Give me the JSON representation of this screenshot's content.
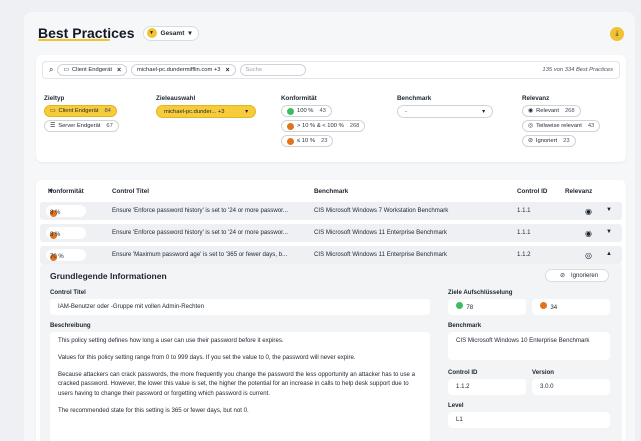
{
  "header": {
    "title": "Best Practices",
    "scope": "Gesamt"
  },
  "search": {
    "chips": [
      "Client Endgerät",
      "michael-pc.dundermifflin.com +3"
    ],
    "placeholder": "Suche",
    "count": "135 von 334 Best Practices"
  },
  "filters": {
    "zieltyp": {
      "label": "Zieltyp",
      "options": [
        {
          "label": "Client Endgerät",
          "count": "84"
        },
        {
          "label": "Server Endgerät",
          "count": "67"
        }
      ]
    },
    "zielauswahl": {
      "label": "Zieleauswahl",
      "value": "michael-pc.dunder... +3"
    },
    "konformitaet": {
      "label": "Konformität",
      "options": [
        {
          "label": "100 %",
          "count": "43"
        },
        {
          "label": "> 10 % & < 100 %",
          "count": "268"
        },
        {
          "label": "≤ 10 %",
          "count": "23"
        }
      ]
    },
    "benchmark": {
      "label": "Benchmark",
      "value": "-"
    },
    "relevanz": {
      "label": "Relevanz",
      "options": [
        {
          "label": "Relevant",
          "count": "268"
        },
        {
          "label": "Teilweise relevant",
          "count": "43"
        },
        {
          "label": "Ignoriert",
          "count": "23"
        }
      ]
    }
  },
  "table": {
    "headers": [
      "Konformität",
      "Control Titel",
      "Benchmark",
      "Control ID",
      "Relevanz"
    ],
    "rows": [
      {
        "pct": "8 %",
        "title": "Ensure 'Enforce password history' is set to '24 or more passwor...",
        "benchmark": "CIS Microsoft Windows 7 Workstation Benchmark",
        "id": "1.1.1"
      },
      {
        "pct": "8 %",
        "title": "Ensure 'Enforce password history' is set to '24 or more passwor...",
        "benchmark": "CIS Microsoft Windows 11 Enterprise Benchmark",
        "id": "1.1.1"
      },
      {
        "pct": "70 %",
        "title": "Ensure 'Maximum password age' is set to '365 or fewer days, b...",
        "benchmark": "CIS Microsoft Windows 11 Enterprise Benchmark",
        "id": "1.1.2"
      }
    ]
  },
  "detail": {
    "heading": "Grundlegende Informationen",
    "ignore_label": "Ignorieren",
    "control_title_label": "Control Titel",
    "control_title_value": "IAM-Benutzer oder -Gruppe mit vollen Admin-Rechten",
    "ziele_label": "Ziele Aufschlüsselung",
    "ziele_green": "78",
    "ziele_orange": "34",
    "beschreibung_label": "Beschreibung",
    "beschreibung": [
      "This policy setting defines how long a user can use their password before it expires.",
      "Values for this policy setting range from 0 to 999 days. If you set the value to 0, the password will never expire.",
      "Because attackers can crack passwords, the more frequently you change the password the less opportunity an attacker has to use a cracked password. However, the lower this value is set, the higher the potential for an increase in calls to help desk support due to users having to change their password or forgetting which password is current.",
      "The recommended state for this setting is 365 or fewer days, but not 0."
    ],
    "benchmark_label": "Benchmark",
    "benchmark_value": "CIS Microsoft Windows 10 Enterprise Benchmark",
    "control_id_label": "Control ID",
    "control_id_value": "1.1.2",
    "version_label": "Version",
    "version_value": "3.0.0",
    "level_label": "Level",
    "level_value": "L1"
  }
}
